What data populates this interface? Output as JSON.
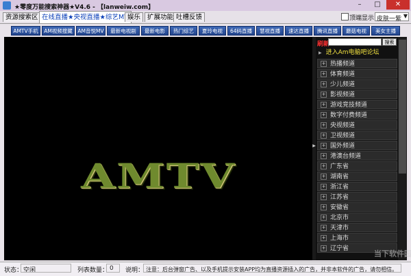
{
  "window": {
    "title": "★零度万能搜索神器★V4.6 - 【lanweiw.com】",
    "min": "–",
    "max": "□",
    "close": "✕"
  },
  "tabs": [
    "资源搜索区",
    "在线直播★央视直播★综艺MV",
    "娱乐",
    "扩展功能",
    "吐槽反馈"
  ],
  "top_options": {
    "checkbox_label": "顶端显示",
    "skin_value": "皮肤一紫"
  },
  "channels": [
    "AMTV手机",
    "AM视频搜藏",
    "AM音悦MV",
    "最新电视剧",
    "最新电影",
    "热门综艺",
    "夏玲电视",
    "64码直播",
    "慧视直播",
    "速达直播",
    "腾讯直播",
    "蘑菇电视",
    "美女主播"
  ],
  "player": {
    "logo_text": "AMTV"
  },
  "panel": {
    "refresh_label": "刷新",
    "search_button": "搜索",
    "forum_link": "进入Am电脑吧论坛",
    "items": [
      "热播频道",
      "体育频道",
      "少儿频道",
      "影视频道",
      "游戏竞技频道",
      "数字付费频道",
      "央视频道",
      "卫视频道",
      "国外频道",
      "港澳台频道",
      "广东省",
      "湖南省",
      "浙江省",
      "江苏省",
      "安徽省",
      "北京市",
      "天津市",
      "上海市",
      "辽宁省"
    ]
  },
  "status": {
    "state_label": "状态：",
    "state_value": "空闲",
    "count_label": "列表数量：",
    "count_value": "0",
    "note_label": "说明：",
    "note_value": "注意：后台弹窗广告、以及手机提示安装APP均为直播资源插入的广告，并非本软件的广告，请勿相信。"
  },
  "watermark": "当下软件园"
}
